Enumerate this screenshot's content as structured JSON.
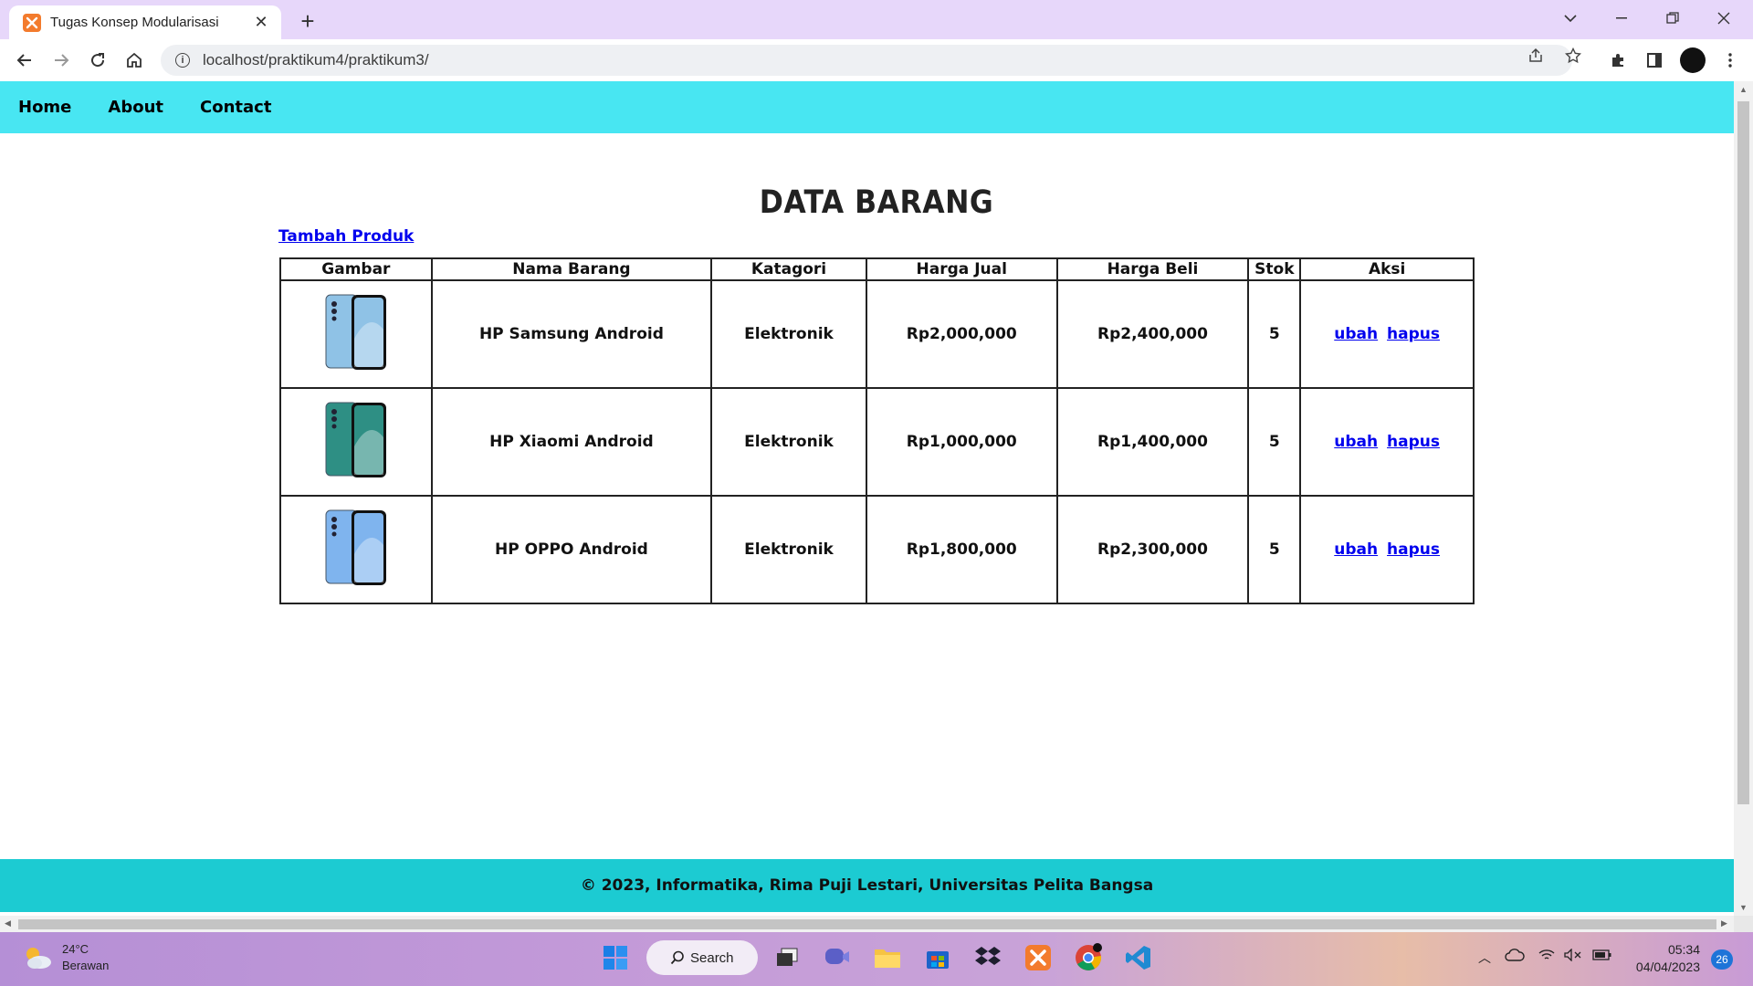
{
  "browser": {
    "tab_title": "Tugas Konsep Modularisasi",
    "url": "localhost/praktikum4/praktikum3/"
  },
  "nav": {
    "items": [
      "Home",
      "About",
      "Contact"
    ]
  },
  "page": {
    "title": "DATA BARANG",
    "add_link": "Tambah Produk"
  },
  "table": {
    "headers": [
      "Gambar",
      "Nama Barang",
      "Katagori",
      "Harga Jual",
      "Harga Beli",
      "Stok",
      "Aksi"
    ],
    "rows": [
      {
        "name": "HP Samsung Android",
        "category": "Elektronik",
        "sell": "Rp2,000,000",
        "buy": "Rp2,400,000",
        "stock": "5",
        "edit": "ubah",
        "delete": "hapus",
        "phone_color": "#8fc2e6"
      },
      {
        "name": "HP Xiaomi Android",
        "category": "Elektronik",
        "sell": "Rp1,000,000",
        "buy": "Rp1,400,000",
        "stock": "5",
        "edit": "ubah",
        "delete": "hapus",
        "phone_color": "#2e8f84"
      },
      {
        "name": "HP OPPO Android",
        "category": "Elektronik",
        "sell": "Rp1,800,000",
        "buy": "Rp2,300,000",
        "stock": "5",
        "edit": "ubah",
        "delete": "hapus",
        "phone_color": "#7fb4ee"
      }
    ]
  },
  "footer": {
    "text": "© 2023, Informatika, Rima Puji Lestari, Universitas Pelita Bangsa"
  },
  "taskbar": {
    "temperature": "24°C",
    "weather": "Berawan",
    "search": "Search",
    "time": "05:34",
    "date": "04/04/2023",
    "notifications": "26"
  },
  "colors": {
    "nav_bg": "#48e6f2",
    "footer_bg": "#1ccbd2",
    "link": "#0000ee",
    "tabstrip": "#e7d7fa"
  }
}
